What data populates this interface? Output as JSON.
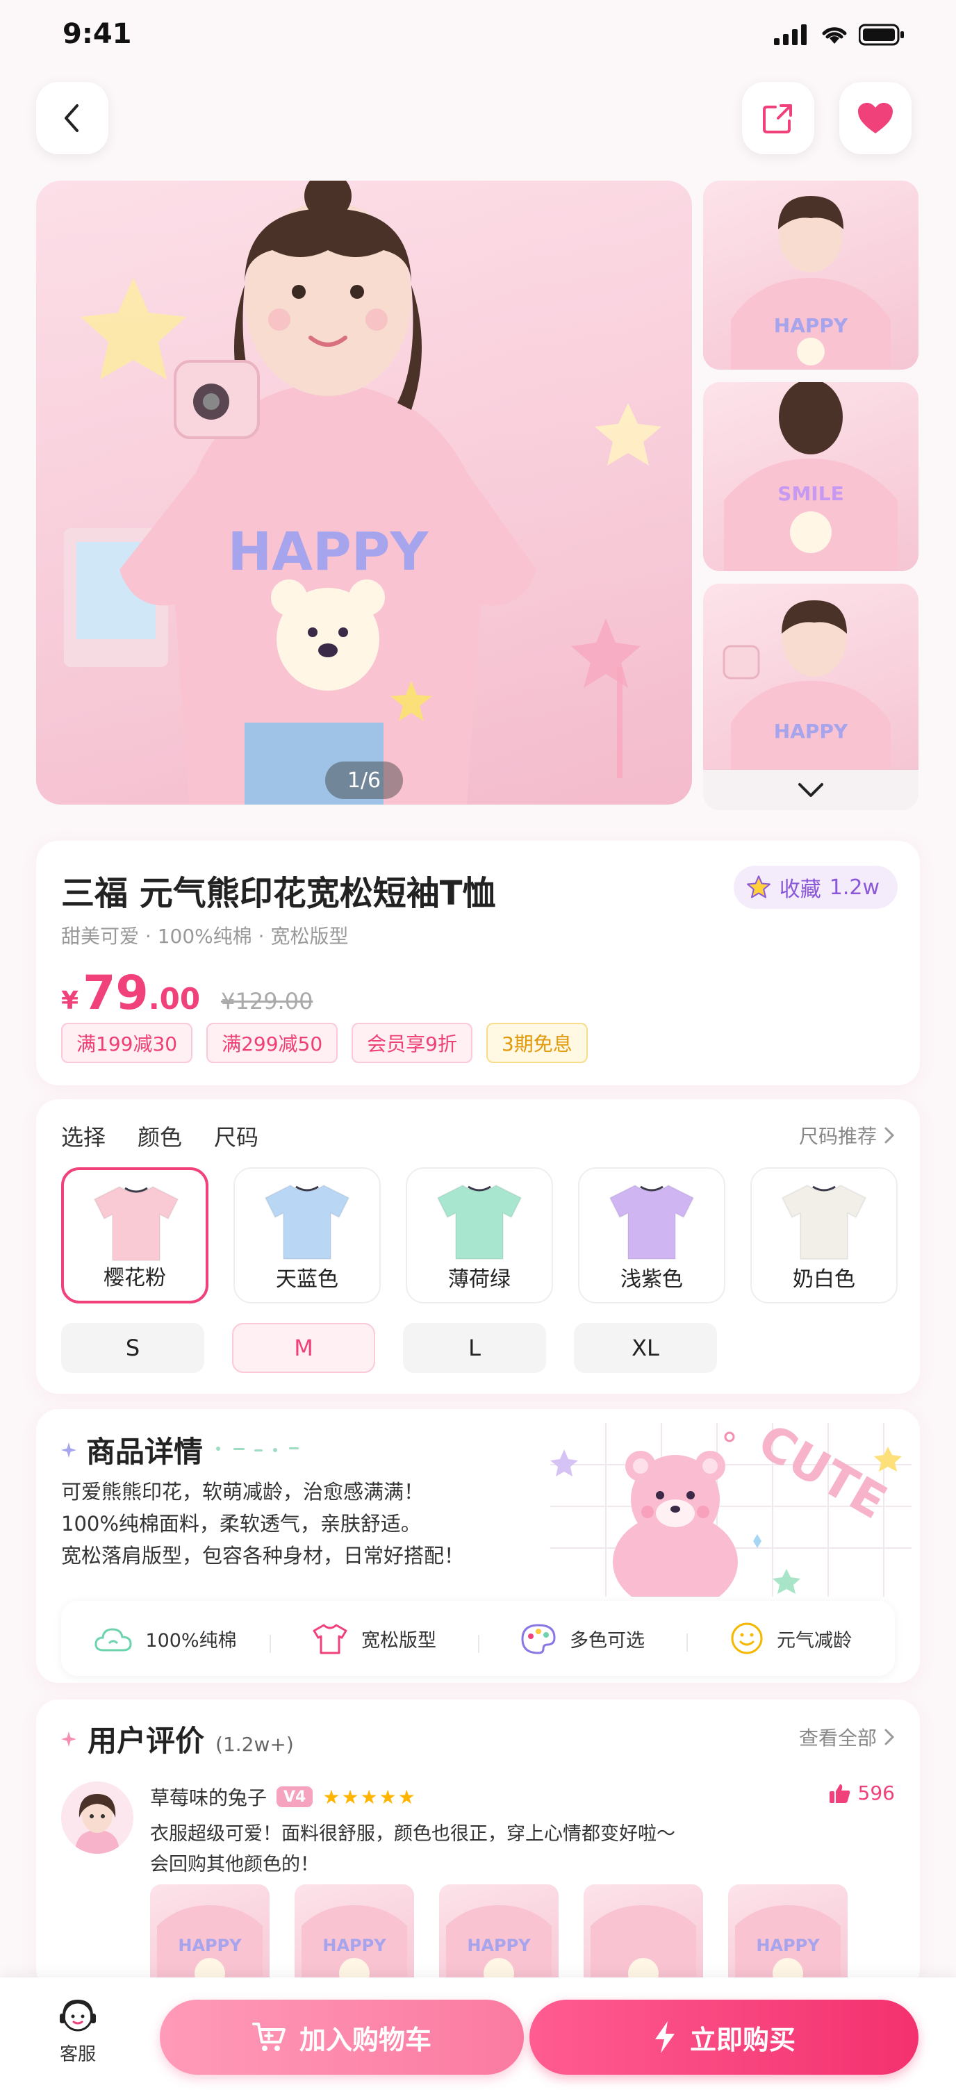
{
  "status_bar": {
    "time": "9:41"
  },
  "gallery": {
    "indicator": "1/6",
    "main_print_text": "HAPPY",
    "thumb_print_texts": [
      "HAPPY",
      "SMILE",
      "HAPPY"
    ]
  },
  "product": {
    "title": "三福 元气熊印花宽松短袖T恤",
    "favorite_label": "收藏",
    "favorite_count": "1.2w",
    "subtitle": "甜美可爱 · 100%纯棉 · 宽松版型",
    "price_currency": "¥",
    "price_integer": "79",
    "price_decimal": ".00",
    "original_price": "¥129.00",
    "promo_tags": [
      "满199减30",
      "满299减50",
      "会员享9折",
      "3期免息"
    ]
  },
  "selection": {
    "tabs": [
      "选择",
      "颜色",
      "尺码"
    ],
    "size_guide": "尺码推荐",
    "colors": [
      {
        "label": "樱花粉",
        "swatch": "#f9c9d4",
        "selected": true
      },
      {
        "label": "天蓝色",
        "swatch": "#b9d6f4",
        "selected": false
      },
      {
        "label": "薄荷绿",
        "swatch": "#a9e6cf",
        "selected": false
      },
      {
        "label": "浅紫色",
        "swatch": "#cfb6f3",
        "selected": false
      },
      {
        "label": "奶白色",
        "swatch": "#f1efe8",
        "selected": false
      }
    ],
    "sizes": [
      "S",
      "M",
      "L",
      "XL"
    ],
    "selected_size": "M"
  },
  "details": {
    "heading": "商品详情",
    "lines": [
      "可爱熊熊印花，软萌减龄，治愈感满满！",
      "100%纯棉面料，柔软透气，亲肤舒适。",
      "宽松落肩版型，包容各种身材，日常好搭配！"
    ],
    "decor_text": "CUTE",
    "features": [
      "100%纯棉",
      "宽松版型",
      "多色可选",
      "元气减龄"
    ]
  },
  "reviews": {
    "heading": "用户评价",
    "count": "(1.2w+)",
    "view_all": "查看全部",
    "item": {
      "name": "草莓味的兔子",
      "badge": "V4",
      "stars": "★★★★★",
      "likes": "596",
      "text_lines": [
        "衣服超级可爱！面料很舒服，颜色也很正，穿上心情都变好啦～",
        "会回购其他颜色的！"
      ],
      "photo_texts": [
        "HAPPY",
        "HAPPY",
        "HAPPY",
        "",
        "HAPPY"
      ]
    }
  },
  "bottom_bar": {
    "service_label": "客服",
    "add_to_cart": "加入购物车",
    "buy_now": "立即购买"
  },
  "colors": {
    "accent": "#f0417a",
    "accent_light": "#fff0f4",
    "purple": "#8a57d8",
    "star": "#ffb400"
  }
}
